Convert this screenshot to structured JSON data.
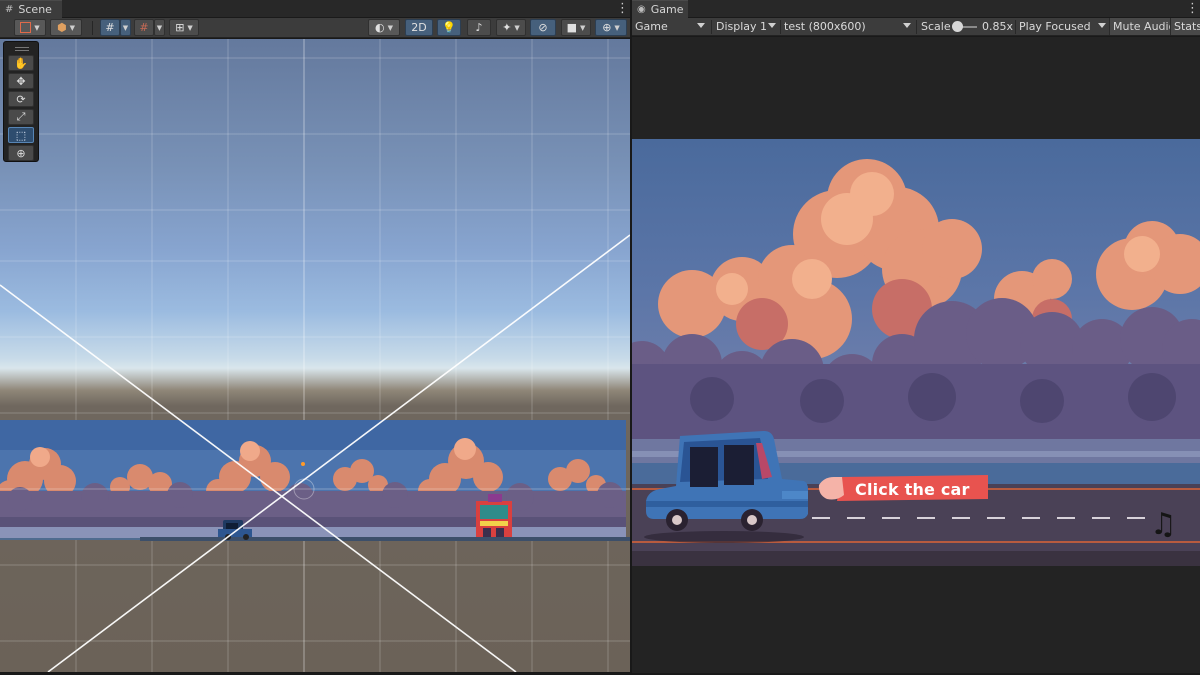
{
  "scene_tab": {
    "label": "Scene",
    "icon": "grid-hash-icon"
  },
  "game_tab": {
    "label": "Game",
    "icon": "gamepad-icon"
  },
  "scene_toolbar": {
    "mode_2d_label": "2D",
    "icons": [
      "draw-mode-icon",
      "cube-icon",
      "grid-snap-icon",
      "increment-snap-icon",
      "ruler-icon",
      "shading-sphere-icon",
      "lighting-bulb-icon",
      "audio-icon",
      "effects-icon",
      "hidden-eye-icon",
      "camera-icon",
      "gizmos-globe-icon"
    ]
  },
  "tools": [
    {
      "name": "hand-tool",
      "icon": "hand-icon",
      "glyph": "✋"
    },
    {
      "name": "move-tool",
      "icon": "move-arrows-icon",
      "glyph": "✥"
    },
    {
      "name": "rotate-tool",
      "icon": "rotate-icon",
      "glyph": "⟳"
    },
    {
      "name": "scale-tool",
      "icon": "scale-icon",
      "glyph": "⤢"
    },
    {
      "name": "rect-tool",
      "icon": "rect-transform-icon",
      "glyph": "⬚"
    },
    {
      "name": "transform-tool",
      "icon": "transform-globe-icon",
      "glyph": "⊕"
    }
  ],
  "game_toolbar": {
    "view_select": "Game",
    "display_select": "Display 1",
    "resolution_select": "test (800x600)",
    "scale_label": "Scale",
    "scale_value": "0.85x",
    "play_mode_select": "Play Focused",
    "mute_audio_label": "Mute Audio",
    "stats_label": "Stats"
  },
  "game": {
    "call_to_action": "Click the car",
    "music_icon": "♫"
  },
  "colors": {
    "editor_bg": "#282828",
    "toolbar_bg": "#3c3c3c",
    "active_blue": "#46607c",
    "banner_red": "#e8534f",
    "car_blue": "#3f74b6"
  }
}
